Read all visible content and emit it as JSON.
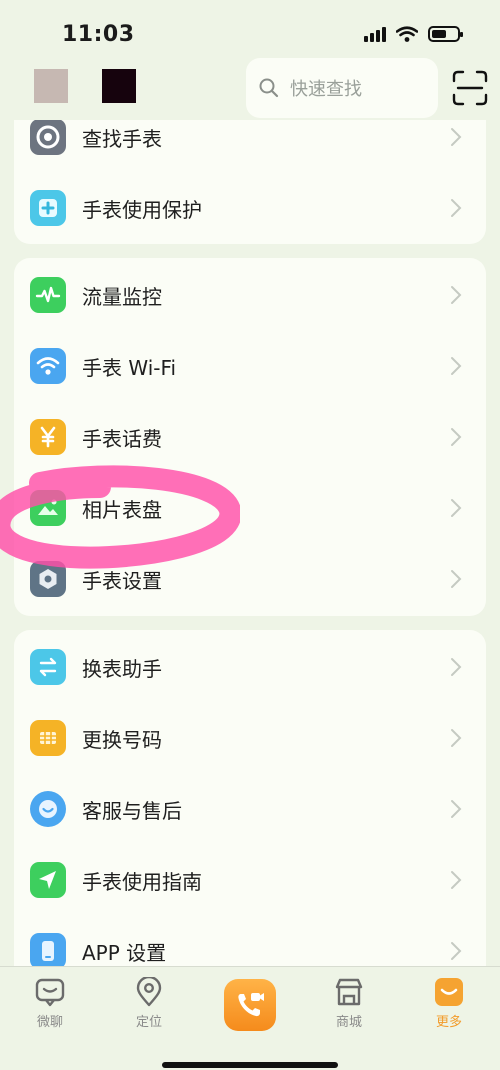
{
  "status": {
    "time": "11:03"
  },
  "search": {
    "placeholder": "快速查找"
  },
  "groups": [
    {
      "items": [
        {
          "label": "查找手表",
          "icon": "find-watch-icon",
          "color": "#6d7480"
        },
        {
          "label": "手表使用保护",
          "icon": "watch-protect-icon",
          "color": "#4cc7e8"
        }
      ]
    },
    {
      "items": [
        {
          "label": "流量监控",
          "icon": "data-monitor-icon",
          "color": "#3dcf5e"
        },
        {
          "label": "手表 Wi-Fi",
          "icon": "wifi-icon",
          "color": "#4aa6f0"
        },
        {
          "label": "手表话费",
          "icon": "yuan-icon",
          "color": "#f5b326"
        },
        {
          "label": "相片表盘",
          "icon": "photo-dial-icon",
          "color": "#3dcf5e"
        },
        {
          "label": "手表设置",
          "icon": "settings-hex-icon",
          "color": "#5f7486"
        }
      ]
    },
    {
      "items": [
        {
          "label": "换表助手",
          "icon": "switch-watch-icon",
          "color": "#4cc7e8"
        },
        {
          "label": "更换号码",
          "icon": "sim-card-icon",
          "color": "#f5b326"
        },
        {
          "label": "客服与售后",
          "icon": "customer-service-icon",
          "color": "#4aa6f0"
        },
        {
          "label": "手表使用指南",
          "icon": "guide-icon",
          "color": "#3dcf5e"
        },
        {
          "label": "APP 设置",
          "icon": "app-settings-icon",
          "color": "#4aa6f0"
        }
      ]
    }
  ],
  "tabs": [
    {
      "label": "微聊",
      "icon": "chat-icon",
      "active": false
    },
    {
      "label": "定位",
      "icon": "location-icon",
      "active": false
    },
    {
      "label": "",
      "icon": "video-call-icon",
      "active": false
    },
    {
      "label": "商城",
      "icon": "store-icon",
      "active": false
    },
    {
      "label": "更多",
      "icon": "more-icon",
      "active": true
    }
  ],
  "colors": {
    "accent": "#f29b2a",
    "background": "#eef4e6",
    "card": "#fbfdf6",
    "highlight": "#ff4fa8"
  }
}
